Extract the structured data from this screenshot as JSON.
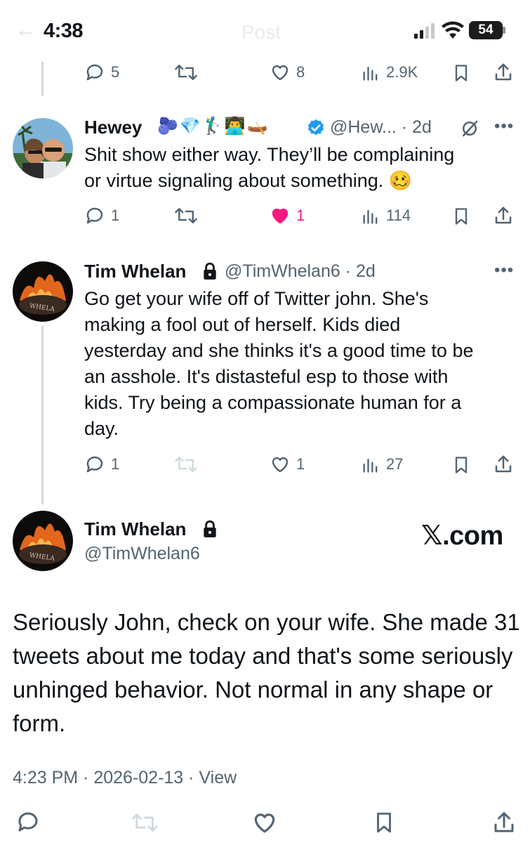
{
  "status_bar": {
    "time": "4:38",
    "battery": "54",
    "back_ghost": "←",
    "title_ghost": "Post"
  },
  "top_actions": {
    "replies": "5",
    "likes": "8",
    "views": "2.9K"
  },
  "reply1": {
    "name": "Hewey",
    "emojis": "🫐💎🏌‍♂👨‍💻🛶",
    "handle": "@Hew... · 2d",
    "text_line1": "Shit show either way. They’ll be complaining",
    "text_line2": "or virtue signaling about something. 🥴",
    "replies": "1",
    "likes": "1",
    "views": "114"
  },
  "reply2": {
    "name": "Tim Whelan",
    "handle": "@TimWhelan6 · 2d",
    "lines": [
      "Go get your wife off of Twitter john. She's",
      "making a fool out of herself. Kids died",
      "yesterday and she thinks it's a good time to be",
      "an asshole. It's distasteful esp to those with",
      "kids. Try being a compassionate human for a",
      "day."
    ],
    "replies": "1",
    "likes": "1",
    "views": "27"
  },
  "main_post": {
    "name": "Tim Whelan",
    "handle": "@TimWhelan6",
    "brand": "𝕏.com",
    "lines": [
      "Seriously John, check on your wife. She made 31",
      "tweets about me today and that's some seriously",
      "unhinged behavior.  Not normal in any shape or",
      "form."
    ],
    "meta": "4:23 PM · 2026-02-13 · View"
  },
  "colors": {
    "like_pink": "#f91880",
    "verified_blue": "#1d9bf0",
    "muted": "#536471"
  }
}
